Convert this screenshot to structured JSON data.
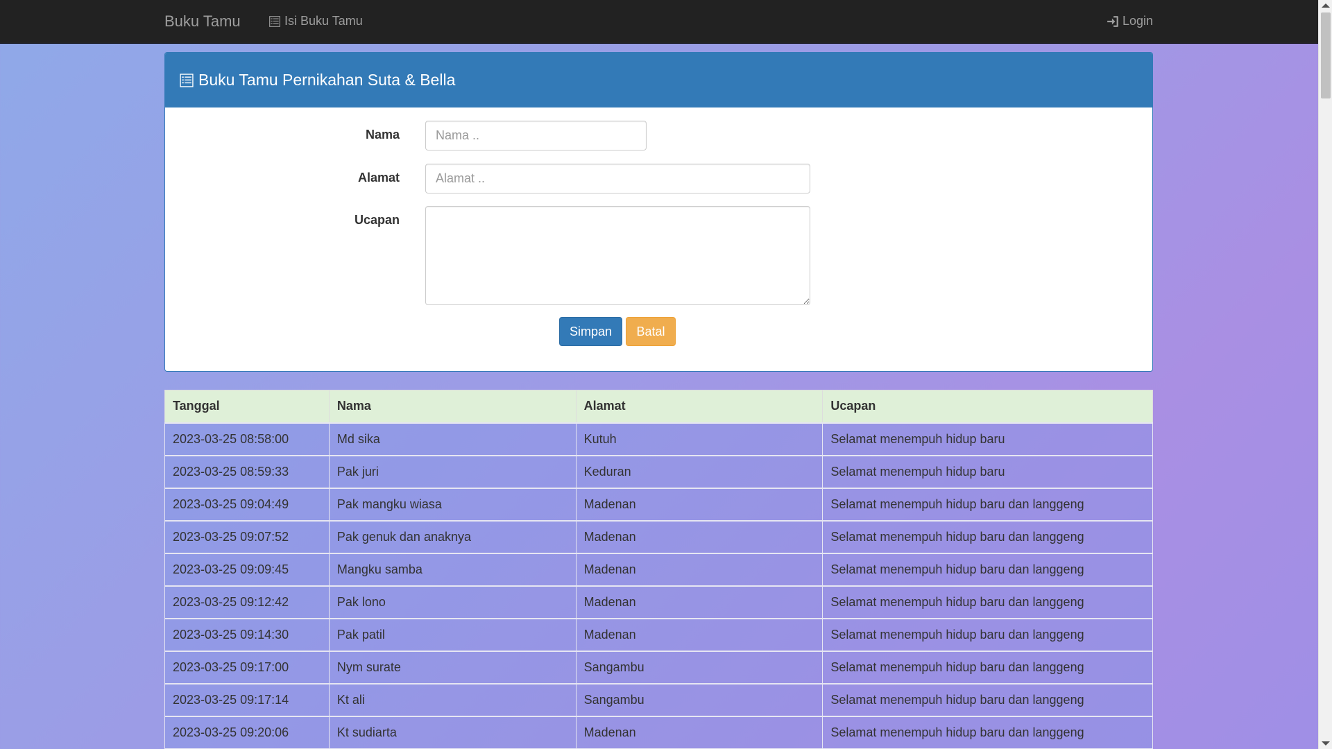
{
  "navbar": {
    "brand": "Buku Tamu",
    "guest_link": "Isi Buku Tamu",
    "login_link": "Login"
  },
  "panel": {
    "title": "Buku Tamu Pernikahan Suta & Bella"
  },
  "form": {
    "nama_label": "Nama",
    "nama_placeholder": "Nama ..",
    "alamat_label": "Alamat",
    "alamat_placeholder": "Alamat ..",
    "ucapan_label": "Ucapan",
    "save_label": "Simpan",
    "cancel_label": "Batal"
  },
  "table": {
    "headers": [
      "Tanggal",
      "Nama",
      "Alamat",
      "Ucapan"
    ],
    "rows": [
      [
        "2023-03-25 08:58:00",
        "Md sika",
        "Kutuh",
        "Selamat menempuh hidup baru"
      ],
      [
        "2023-03-25 08:59:33",
        "Pak juri",
        "Keduran",
        "Selamat menempuh hidup baru"
      ],
      [
        "2023-03-25 09:04:49",
        "Pak mangku wiasa",
        "Madenan",
        "Selamat menempuh hidup baru dan langgeng"
      ],
      [
        "2023-03-25 09:07:52",
        "Pak genuk dan anaknya",
        "Madenan",
        "Selamat menempuh hidup baru dan langgeng"
      ],
      [
        "2023-03-25 09:09:45",
        "Mangku samba",
        "Madenan",
        "Selamat menempuh hidup baru dan langgeng"
      ],
      [
        "2023-03-25 09:12:42",
        "Pak lono",
        "Madenan",
        "Selamat menempuh hidup baru dan langgeng"
      ],
      [
        "2023-03-25 09:14:30",
        "Pak patil",
        "Madenan",
        "Selamat menempuh hidup baru dan langgeng"
      ],
      [
        "2023-03-25 09:17:00",
        "Nym surate",
        "Sangambu",
        "Selamat menempuh hidup baru dan langgeng"
      ],
      [
        "2023-03-25 09:17:14",
        "Kt ali",
        "Sangambu",
        "Selamat menempuh hidup baru dan langgeng"
      ],
      [
        "2023-03-25 09:20:06",
        "Kt sudiarta",
        "Madenan",
        "Selamat menempuh hidup baru dan langgeng"
      ]
    ]
  }
}
